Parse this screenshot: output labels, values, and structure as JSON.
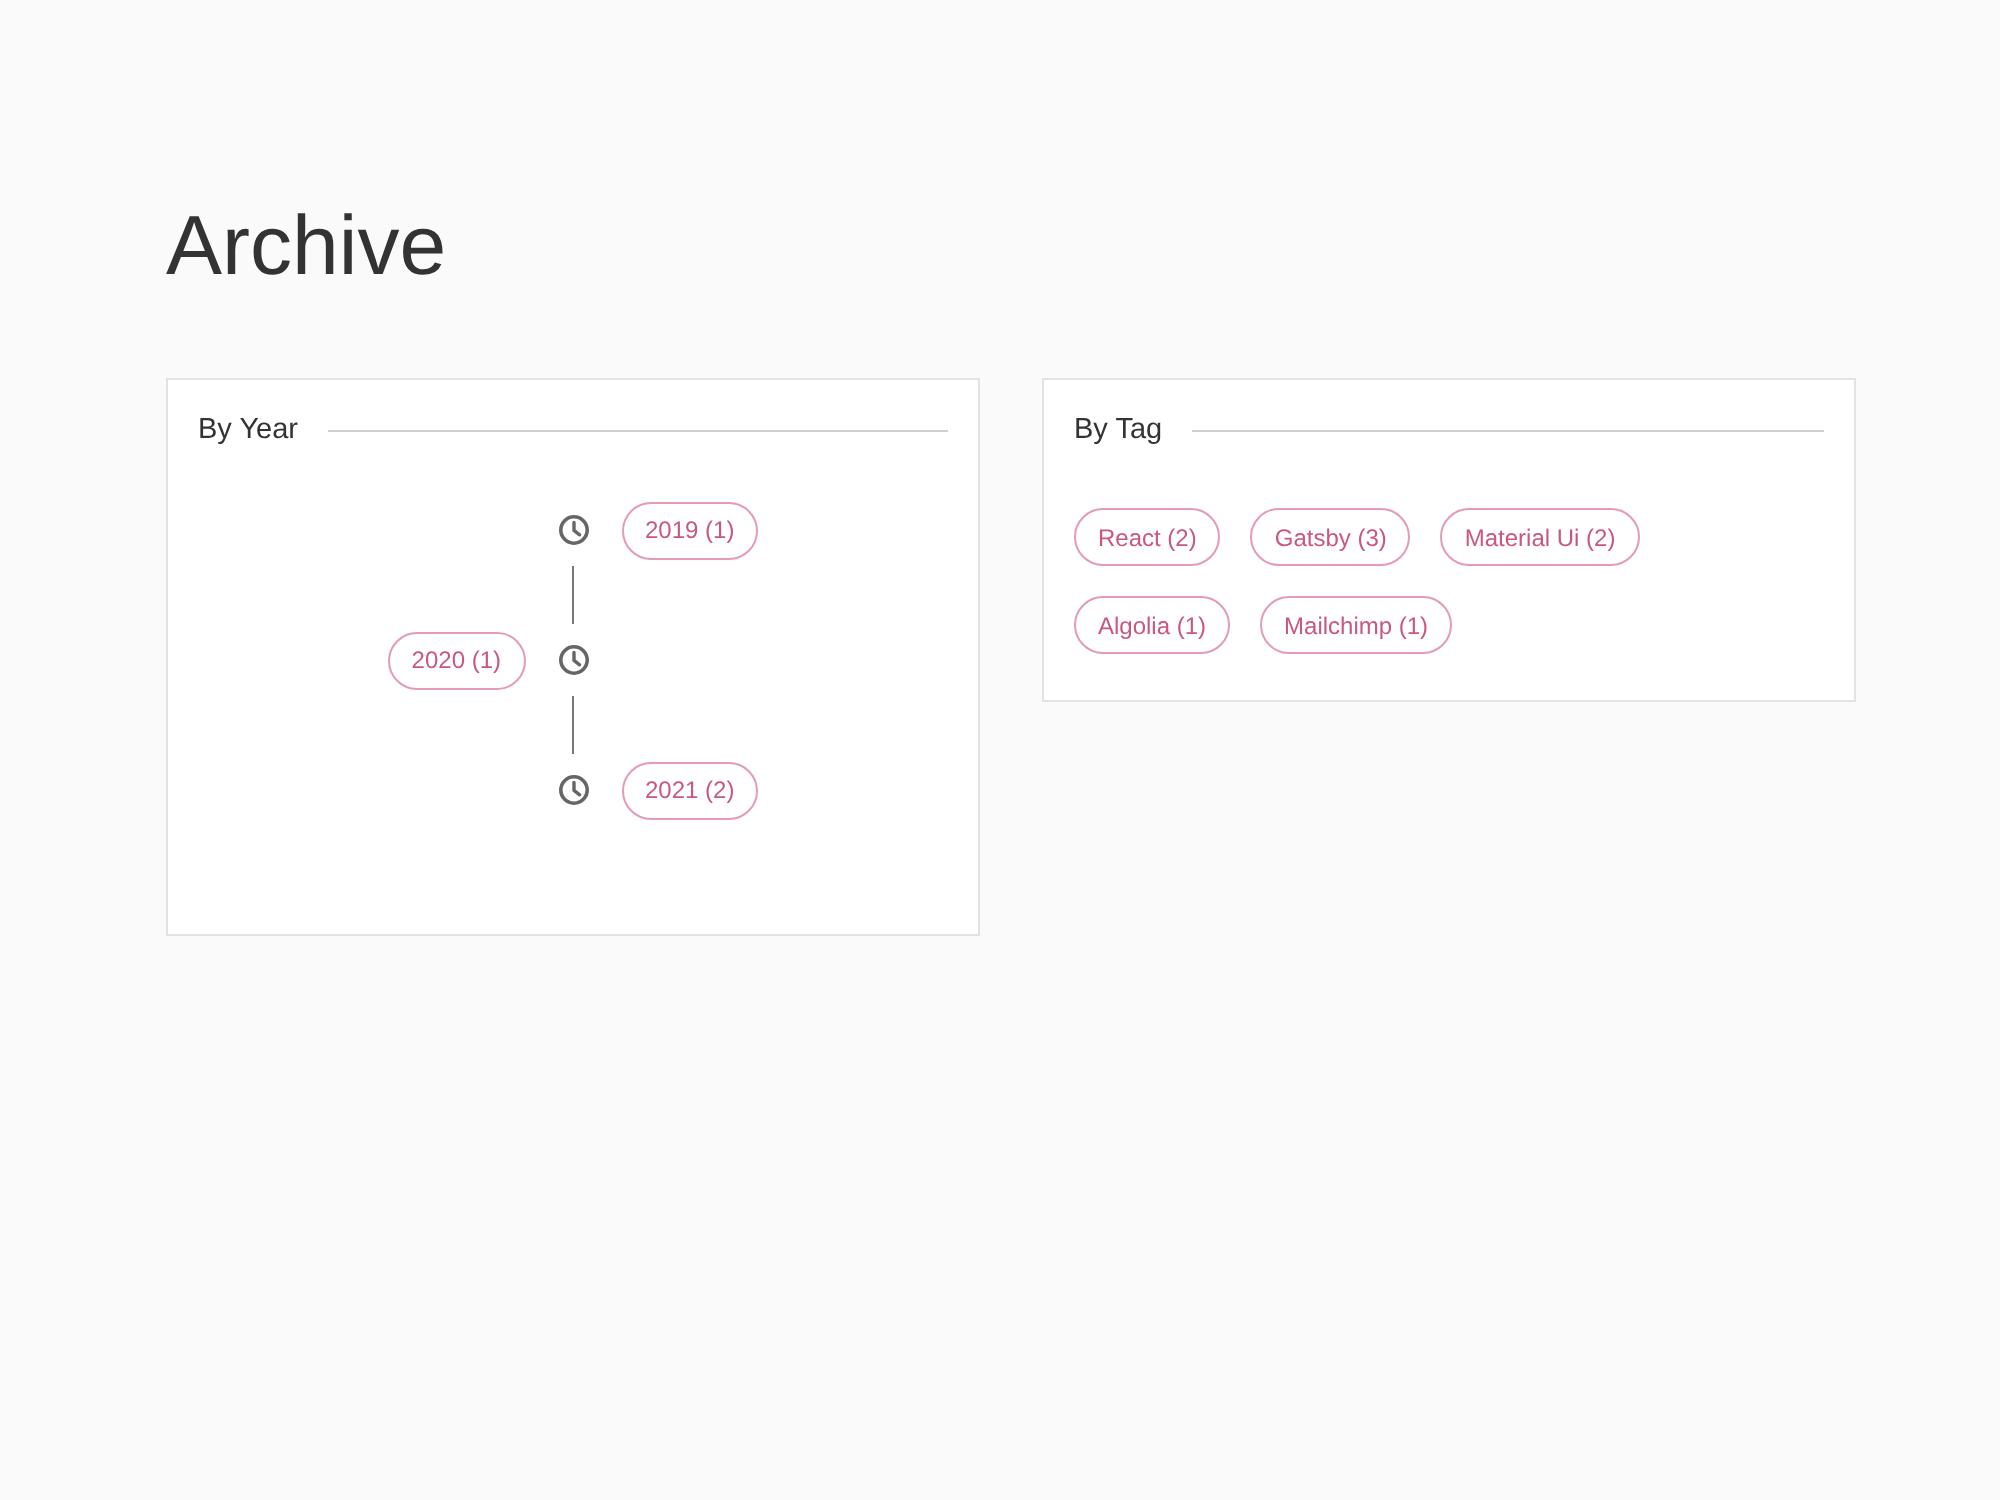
{
  "page": {
    "title": "Archive"
  },
  "by_year": {
    "title": "By Year",
    "items": [
      {
        "label": "2019 (1)",
        "kind": "right"
      },
      {
        "label": "2020 (1)",
        "kind": "left"
      },
      {
        "label": "2021 (2)",
        "kind": "right"
      }
    ]
  },
  "by_tag": {
    "title": "By Tag",
    "tags": [
      "React (2)",
      "Gatsby (3)",
      "Material Ui (2)",
      "Algolia (1)",
      "Mailchimp (1)"
    ]
  }
}
